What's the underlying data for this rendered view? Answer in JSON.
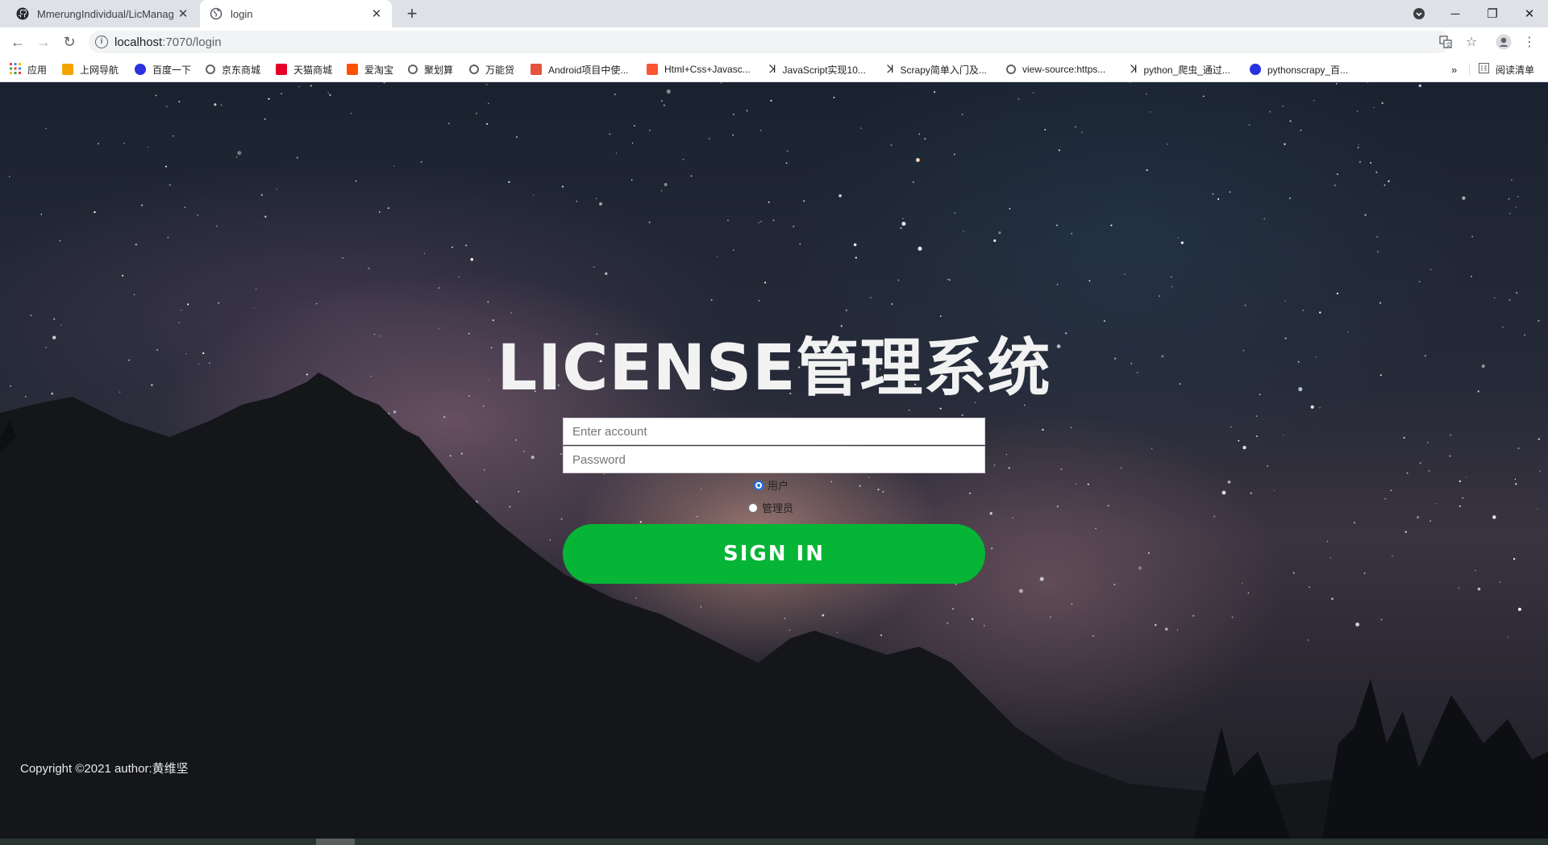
{
  "browser": {
    "tabs": [
      {
        "title": "MmerungIndividual/LicManag",
        "icon": "github-icon",
        "active": false
      },
      {
        "title": "login",
        "icon": "globe-icon",
        "active": true
      }
    ],
    "address": {
      "host": "localhost",
      "path": ":7070/login"
    },
    "bookmarks": [
      {
        "label": "应用",
        "icon": "apps-grid-icon",
        "color": "#ea4335"
      },
      {
        "label": "上网导航",
        "icon": "hao-icon",
        "color": "#f4a300"
      },
      {
        "label": "百度一下",
        "icon": "baidu-paw-icon",
        "color": "#2932e1"
      },
      {
        "label": "京东商城",
        "icon": "globe-icon",
        "color": "#5f6368"
      },
      {
        "label": "天猫商城",
        "icon": "tmall-icon",
        "color": "#e4002b"
      },
      {
        "label": "爱淘宝",
        "icon": "taobao-icon",
        "color": "#ff5000"
      },
      {
        "label": "聚划算",
        "icon": "globe-icon",
        "color": "#5f6368"
      },
      {
        "label": "万能贷",
        "icon": "globe-icon",
        "color": "#5f6368"
      },
      {
        "label": "Android项目中使...",
        "icon": "jian-icon",
        "color": "#e5533d"
      },
      {
        "label": "Html+Css+Javasc...",
        "icon": "csdn-icon",
        "color": "#fc5531"
      },
      {
        "label": "JavaScript实现10...",
        "icon": "yuque-icon",
        "color": "#333333"
      },
      {
        "label": "Scrapy简单入门及...",
        "icon": "yuque-icon",
        "color": "#333333"
      },
      {
        "label": "view-source:https...",
        "icon": "globe-icon",
        "color": "#5f6368"
      },
      {
        "label": "python_爬虫_通过...",
        "icon": "yuque-icon",
        "color": "#333333"
      },
      {
        "label": "pythonscrapy_百...",
        "icon": "baidu-paw-icon",
        "color": "#2932e1"
      }
    ],
    "reading_list": "阅读清单"
  },
  "login": {
    "title": "LICENSE管理系统",
    "account_placeholder": "Enter account",
    "password_placeholder": "Password",
    "role_user": "用户",
    "role_admin": "管理员",
    "selected_role": "用户",
    "signin_label": "SIGN IN",
    "accent": "#06b535"
  },
  "footer": {
    "copyright": "Copyright ©2021 author:黄维坚"
  }
}
